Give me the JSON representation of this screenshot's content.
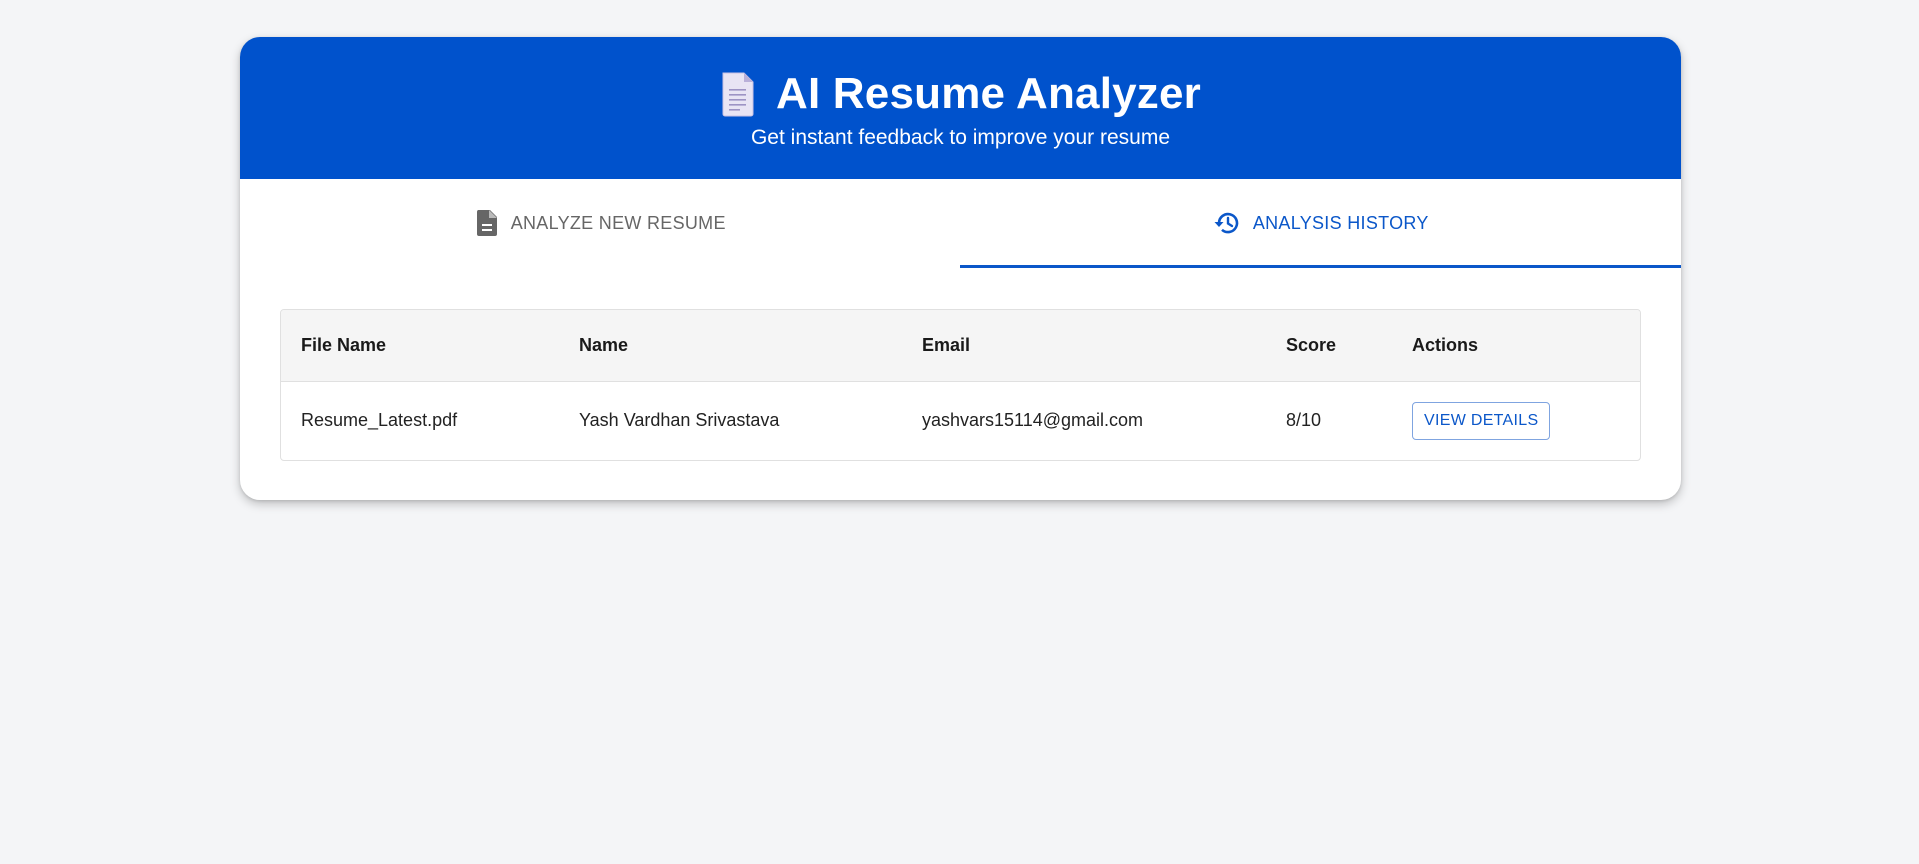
{
  "header": {
    "icon": "page-facing-up-icon",
    "title": "AI Resume Analyzer",
    "subtitle": "Get instant feedback to improve your resume",
    "background_color": "#0052cc"
  },
  "tabs": [
    {
      "label": "ANALYZE NEW RESUME",
      "icon": "document-icon",
      "active": false
    },
    {
      "label": "ANALYSIS HISTORY",
      "icon": "history-icon",
      "active": true
    }
  ],
  "accent_color": "#0b57c9",
  "table": {
    "columns": [
      "File Name",
      "Name",
      "Email",
      "Score",
      "Actions"
    ],
    "rows": [
      {
        "file_name": "Resume_Latest.pdf",
        "name": "Yash Vardhan Srivastava",
        "email": "yashvars15114@gmail.com",
        "score": "8/10",
        "action_label": "VIEW DETAILS"
      }
    ]
  }
}
